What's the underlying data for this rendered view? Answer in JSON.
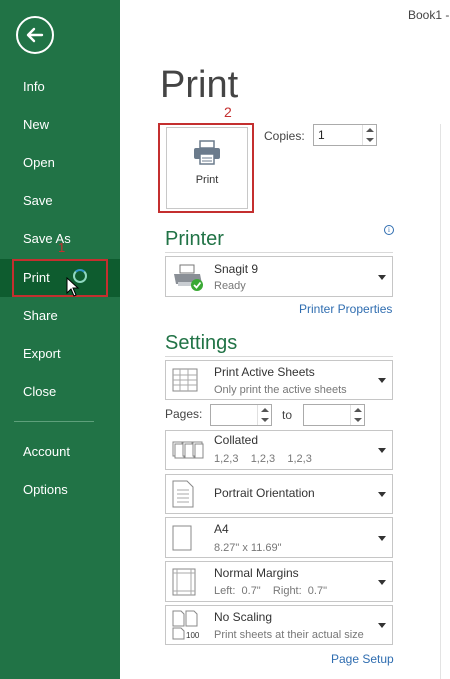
{
  "window": {
    "title": "Book1 -"
  },
  "sidebar": {
    "items": [
      {
        "label": "Info"
      },
      {
        "label": "New"
      },
      {
        "label": "Open"
      },
      {
        "label": "Save"
      },
      {
        "label": "Save As"
      },
      {
        "label": "Print"
      },
      {
        "label": "Share"
      },
      {
        "label": "Export"
      },
      {
        "label": "Close"
      },
      {
        "label": "Account"
      },
      {
        "label": "Options"
      }
    ],
    "active": "Print"
  },
  "annotations": {
    "step1": "1",
    "step2": "2"
  },
  "main": {
    "title": "Print",
    "print_button_label": "Print",
    "copies_label": "Copies:",
    "copies_value": "1",
    "printer_section": "Printer",
    "printer": {
      "name": "Snagit 9",
      "status": "Ready"
    },
    "printer_properties_link": "Printer Properties",
    "settings_section": "Settings",
    "settings": {
      "what": {
        "title": "Print Active Sheets",
        "sub": "Only print the active sheets"
      },
      "pages_label": "Pages:",
      "to_label": "to",
      "collation": {
        "title": "Collated",
        "sub": "1,2,3    1,2,3    1,2,3"
      },
      "orientation": {
        "title": "Portrait Orientation"
      },
      "paper": {
        "title": "A4",
        "sub": "8.27\" x 11.69\""
      },
      "margins": {
        "title": "Normal Margins",
        "sub": "Left:  0.7\"    Right:  0.7\""
      },
      "scaling": {
        "title": "No Scaling",
        "sub": "Print sheets at their actual size"
      }
    },
    "page_setup_link": "Page Setup"
  },
  "colors": {
    "sidebar": "#217346",
    "sidebar_active": "#0e5c2f",
    "annotation": "#c42f2f",
    "link": "#2f6db0"
  }
}
